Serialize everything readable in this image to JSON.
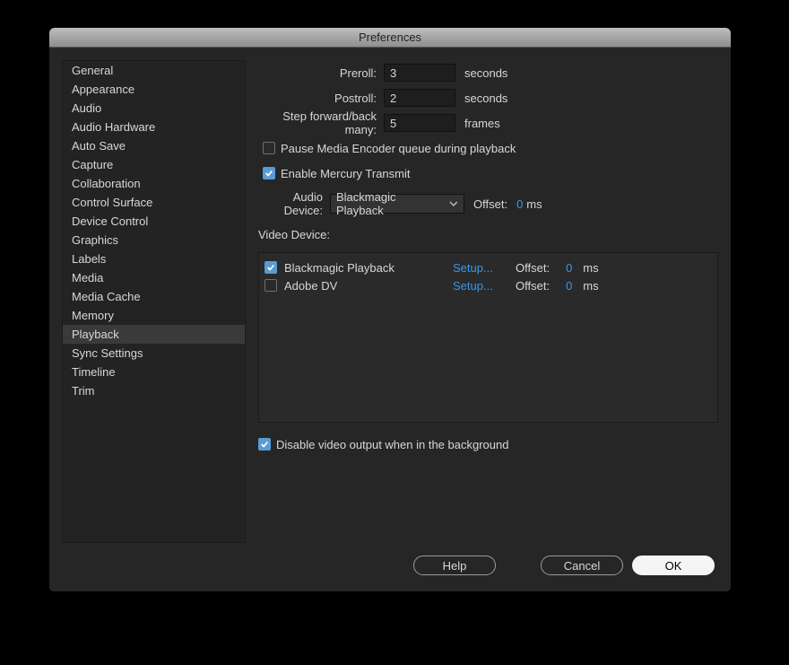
{
  "window": {
    "title": "Preferences"
  },
  "sidebar": {
    "items": [
      {
        "label": "General"
      },
      {
        "label": "Appearance"
      },
      {
        "label": "Audio"
      },
      {
        "label": "Audio Hardware"
      },
      {
        "label": "Auto Save"
      },
      {
        "label": "Capture"
      },
      {
        "label": "Collaboration"
      },
      {
        "label": "Control Surface"
      },
      {
        "label": "Device Control"
      },
      {
        "label": "Graphics"
      },
      {
        "label": "Labels"
      },
      {
        "label": "Media"
      },
      {
        "label": "Media Cache"
      },
      {
        "label": "Memory"
      },
      {
        "label": "Playback",
        "selected": true
      },
      {
        "label": "Sync Settings"
      },
      {
        "label": "Timeline"
      },
      {
        "label": "Trim"
      }
    ]
  },
  "playback": {
    "preroll": {
      "label": "Preroll:",
      "value": "3",
      "unit": "seconds"
    },
    "postroll": {
      "label": "Postroll:",
      "value": "2",
      "unit": "seconds"
    },
    "step": {
      "label": "Step forward/back many:",
      "value": "5",
      "unit": "frames"
    },
    "pause_encoder": {
      "label": "Pause Media Encoder queue during playback",
      "checked": false
    },
    "mercury": {
      "label": "Enable Mercury Transmit",
      "checked": true
    },
    "audio_device": {
      "label": "Audio Device:",
      "value": "Blackmagic Playback",
      "offset_label": "Offset:",
      "offset_value": "0",
      "offset_unit": "ms"
    },
    "video_label": "Video Device:",
    "video_devices": [
      {
        "name": "Blackmagic Playback",
        "checked": true,
        "setup": "Setup...",
        "offset_label": "Offset:",
        "offset_value": "0",
        "offset_unit": "ms"
      },
      {
        "name": "Adobe DV",
        "checked": false,
        "setup": "Setup...",
        "offset_label": "Offset:",
        "offset_value": "0",
        "offset_unit": "ms"
      }
    ],
    "disable_bg": {
      "label": "Disable video output when in the background",
      "checked": true
    }
  },
  "buttons": {
    "help": "Help",
    "cancel": "Cancel",
    "ok": "OK"
  }
}
